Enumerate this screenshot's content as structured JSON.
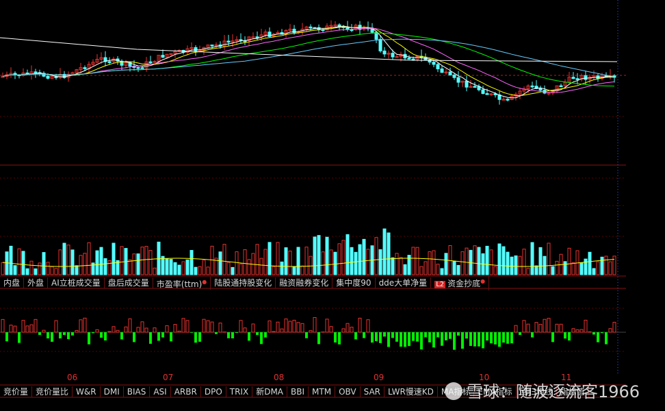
{
  "chart_data": [
    {
      "type": "candlestick",
      "title": "",
      "note": "main price panel with moving averages",
      "ma_colors": [
        "#ffffff",
        "#ffff00",
        "#ff66ff",
        "#00ff00",
        "#66ccff"
      ]
    },
    {
      "type": "bar",
      "title": "",
      "note": "volume panel with moving average lines"
    },
    {
      "type": "bar",
      "title": "",
      "note": "capital-flow histogram, positive red / negative green"
    }
  ],
  "x_axis_months": [
    "06",
    "07",
    "08",
    "09",
    "10",
    "11"
  ],
  "indicator_tabs": [
    {
      "label": "内盘",
      "star": false,
      "badge": ""
    },
    {
      "label": "外盘",
      "star": false,
      "badge": ""
    },
    {
      "label": "AI立桩成交量",
      "star": false,
      "badge": ""
    },
    {
      "label": "盘后成交量",
      "star": false,
      "badge": ""
    },
    {
      "label": "市盈率(ttm)",
      "star": true,
      "badge": ""
    },
    {
      "label": "陆股通持股变化",
      "star": false,
      "badge": ""
    },
    {
      "label": "融资融券变化",
      "star": false,
      "badge": ""
    },
    {
      "label": "集中度90",
      "star": false,
      "badge": ""
    },
    {
      "label": "dde大单净量",
      "star": false,
      "badge": ""
    },
    {
      "label": "资金抄底",
      "star": true,
      "badge": "L2"
    }
  ],
  "tech_tabs": [
    "竞价量",
    "竞价量比",
    "W&R",
    "DMI",
    "BIAS",
    "ASI",
    "ARBR",
    "DPO",
    "TRIX",
    "新DMA",
    "BBI",
    "MTM",
    "OBV",
    "SAR",
    "LWR慢速KD",
    "MA指标",
    "EMA指标",
    "回归均线",
    "指标值"
  ],
  "watermark": "雪球：随波逐流客1966",
  "colors": {
    "up": "#e8322e",
    "down": "#54ffff",
    "neg_flow": "#00ee00",
    "grid": "#7a0000",
    "bg": "#000000"
  }
}
